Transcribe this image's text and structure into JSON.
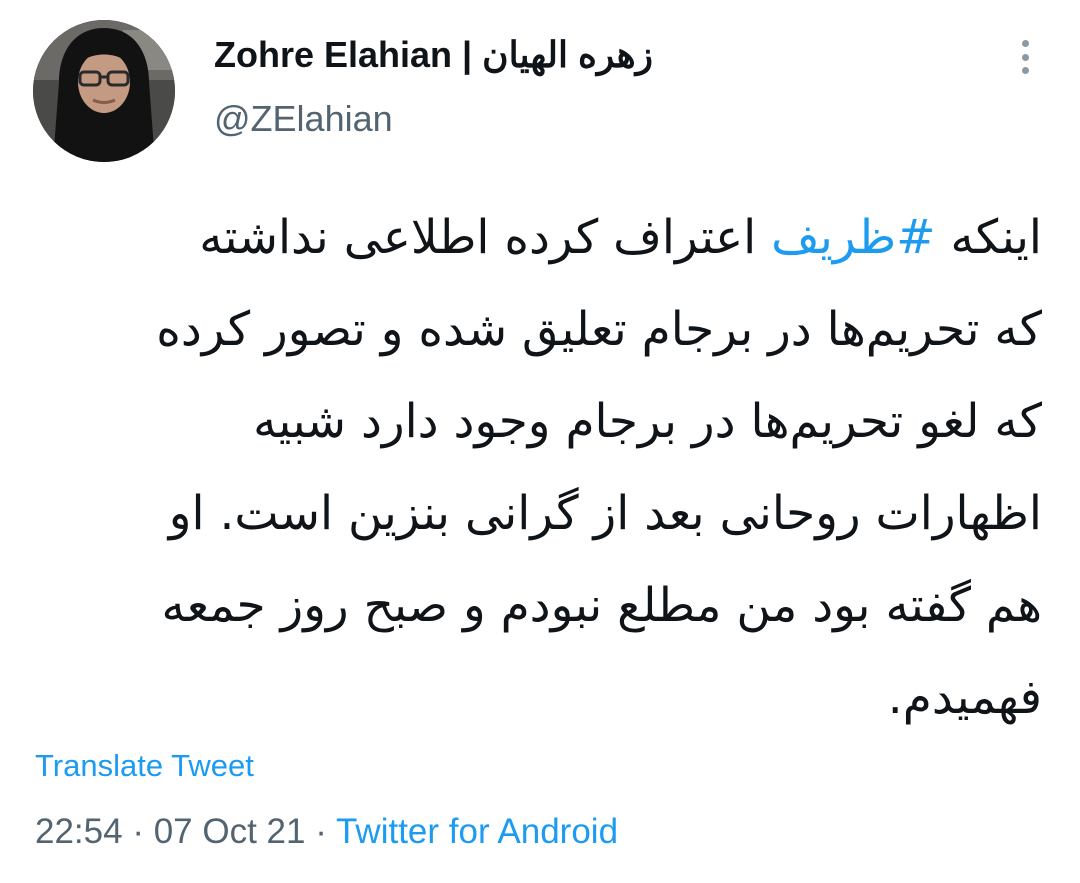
{
  "tweet": {
    "author": {
      "display_name": "Zohre Elahian | زهره الهیان",
      "handle": "@ZElahian"
    },
    "text": {
      "lines": [
        {
          "before": "اینکه ",
          "hashtag": "#ظریف",
          "after": " اعتراف کرده اطلاعی نداشته"
        },
        {
          "text": "که تحریم‌ها در برجام تعلیق شده و تصور کرده"
        },
        {
          "text": "که لغو تحریم‌ها در برجام وجود دارد شبیه"
        },
        {
          "text": "اظهارات روحانی بعد از گرانی بنزین است. او"
        },
        {
          "text": "هم گفته بود من مطلع نبودم و صبح روز جمعه"
        },
        {
          "text": "فهمیدم."
        }
      ]
    },
    "translate_label": "Translate Tweet",
    "time": "22:54",
    "date": "07 Oct 21",
    "separator": "·",
    "source": "Twitter for Android"
  },
  "icons": {
    "more": "more-vertical-icon"
  },
  "colors": {
    "text": "#0f1419",
    "secondary": "#536471",
    "link": "#1d9bf0",
    "background": "#ffffff"
  }
}
